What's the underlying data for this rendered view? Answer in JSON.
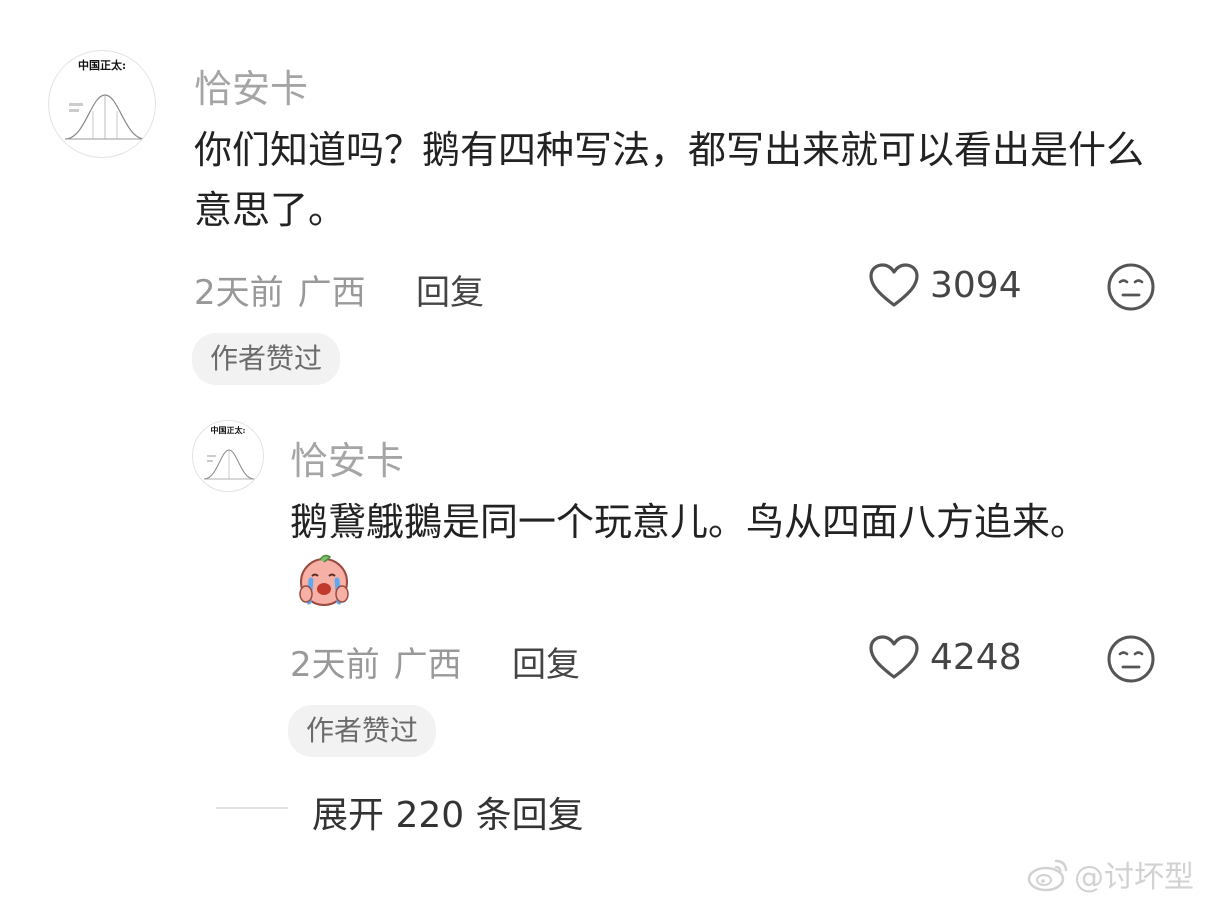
{
  "comments": [
    {
      "avatar_caption": "中国正太:",
      "username": "恰安卡",
      "text": "你们知道吗？鹅有四种写法，都写出来就可以看出是什么意思了。",
      "time": "2天前",
      "location": "广西",
      "reply_label": "回复",
      "likes": "3094",
      "liked_badge": "作者赞过"
    },
    {
      "avatar_caption": "中国正太:",
      "username": "恰安卡",
      "text": "鹅鵞䳘鵝是同一个玩意儿。鸟从四面八方追来。",
      "emoji": "crying-face-sticker",
      "time": "2天前",
      "location": "广西",
      "reply_label": "回复",
      "likes": "4248",
      "liked_badge": "作者赞过"
    }
  ],
  "expand_replies_label": "展开 220 条回复",
  "watermark": "@讨坏型",
  "icons": {
    "like": "heart-outline-icon",
    "reaction": "meh-face-icon",
    "watermark": "weibo-logo-icon"
  },
  "colors": {
    "username": "#a5a5a5",
    "meta": "#999999",
    "badge_bg": "#f2f2f2",
    "text": "#222222"
  }
}
